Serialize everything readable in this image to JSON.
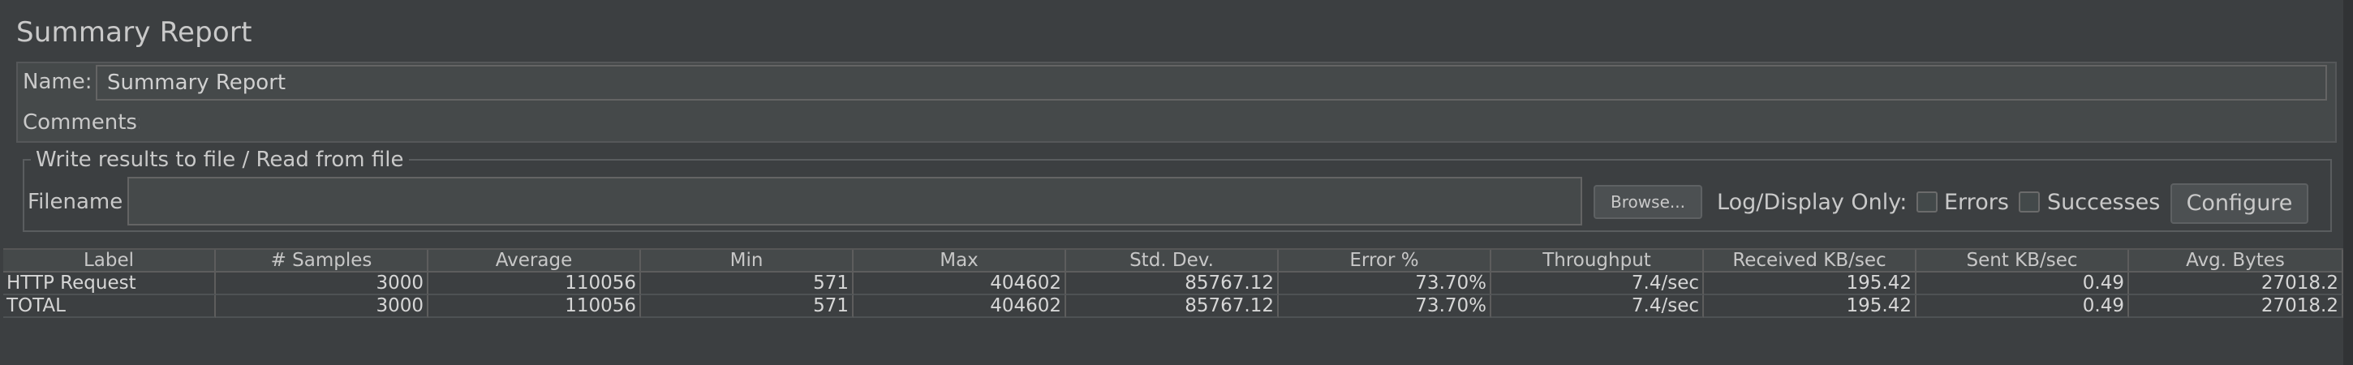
{
  "title": "Summary Report",
  "name_field": {
    "label": "Name:",
    "value": "Summary Report"
  },
  "comments_field": {
    "label": "Comments:",
    "value": ""
  },
  "file_section": {
    "legend": "Write results to file / Read from file",
    "filename_label": "Filename",
    "filename_value": "",
    "browse_label": "Browse...",
    "log_display_label": "Log/Display Only:",
    "errors_label": "Errors",
    "errors_checked": false,
    "successes_label": "Successes",
    "successes_checked": false,
    "configure_label": "Configure"
  },
  "table": {
    "columns": [
      "Label",
      "# Samples",
      "Average",
      "Min",
      "Max",
      "Std. Dev.",
      "Error %",
      "Throughput",
      "Received KB/sec",
      "Sent KB/sec",
      "Avg. Bytes"
    ],
    "rows": [
      [
        "HTTP Request",
        "3000",
        "110056",
        "571",
        "404602",
        "85767.12",
        "73.70%",
        "7.4/sec",
        "195.42",
        "0.49",
        "27018.2"
      ],
      [
        "TOTAL",
        "3000",
        "110056",
        "571",
        "404602",
        "85767.12",
        "73.70%",
        "7.4/sec",
        "195.42",
        "0.49",
        "27018.2"
      ]
    ]
  }
}
